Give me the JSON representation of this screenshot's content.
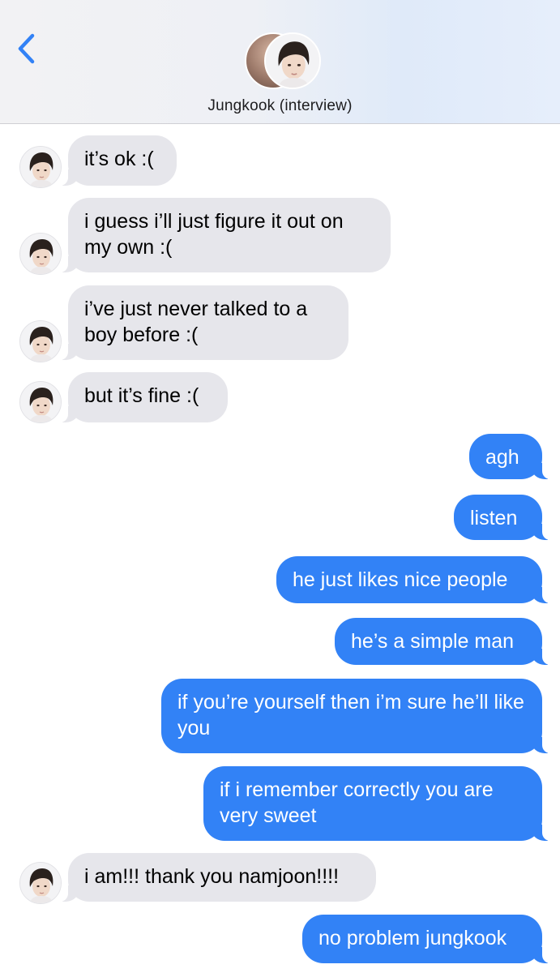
{
  "header": {
    "contact_name": "Jungkook (interview)",
    "back_icon": "chevron-left-icon",
    "accent_color": "#3282f6"
  },
  "messages": [
    {
      "direction": "incoming",
      "text": "it’s ok :("
    },
    {
      "direction": "incoming",
      "text": "i guess i’ll just figure it out on my own :("
    },
    {
      "direction": "incoming",
      "text": "i’ve just never talked to a boy before :("
    },
    {
      "direction": "incoming",
      "text": "but it’s fine :("
    },
    {
      "direction": "outgoing",
      "text": "agh"
    },
    {
      "direction": "outgoing",
      "text": "listen"
    },
    {
      "direction": "outgoing",
      "text": "he just likes nice people"
    },
    {
      "direction": "outgoing",
      "text": "he’s a simple man"
    },
    {
      "direction": "outgoing",
      "text": "if you’re yourself then i’m sure he’ll like you"
    },
    {
      "direction": "outgoing",
      "text": "if i remember correctly you are very sweet"
    },
    {
      "direction": "incoming",
      "text": "i am!!! thank you namjoon!!!!"
    },
    {
      "direction": "outgoing",
      "text": "no problem jungkook"
    }
  ],
  "colors": {
    "incoming_bubble": "#e6e6eb",
    "outgoing_bubble": "#3282f6"
  }
}
